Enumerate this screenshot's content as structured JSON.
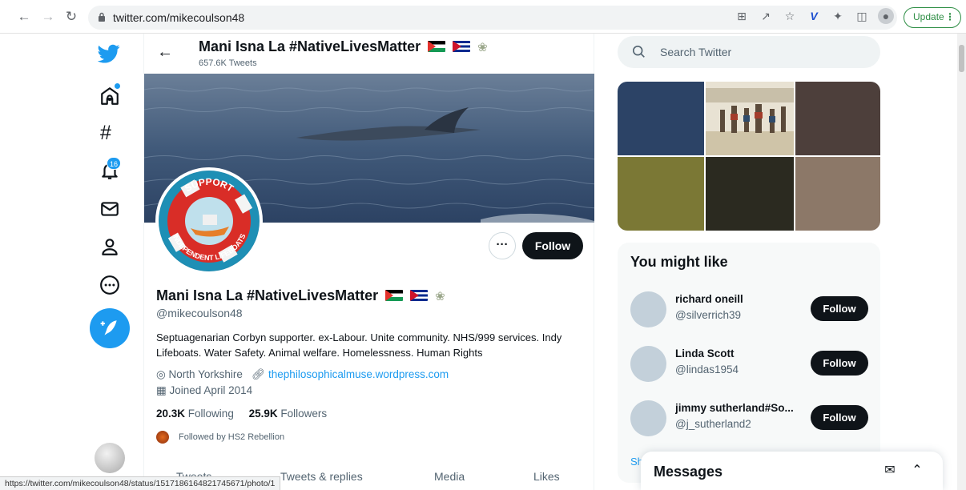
{
  "browser": {
    "url": "twitter.com/mikecoulson48",
    "update_label": "Update",
    "status_url": "https://twitter.com/mikecoulson48/status/1517186164821745671/photo/1"
  },
  "nav": {
    "notification_count": "16"
  },
  "header": {
    "name": "Mani Isna La #NativeLivesMatter",
    "tweets_count": "657.6K Tweets"
  },
  "profile": {
    "name": "Mani Isna La #NativeLivesMatter",
    "handle": "@mikecoulson48",
    "bio": "Septuagenarian Corbyn supporter. ex-Labour. Unite community. NHS/999 services. Indy Lifeboats. Water Safety. Animal welfare. Homelessness. Human Rights",
    "location": "North Yorkshire",
    "website": "thephilosophicalmuse.wordpress.com",
    "joined": "Joined April 2014",
    "following_count": "20.3K",
    "following_label": "Following",
    "followers_count": "25.9K",
    "followers_label": "Followers",
    "followed_by": "Followed by HS2 Rebellion",
    "follow_label": "Follow",
    "avatar_text_top": "SUPPORT",
    "avatar_text_bottom": "INDEPENDENT LIFEBOATS"
  },
  "tabs": [
    {
      "label": "Tweets"
    },
    {
      "label": "Tweets & replies"
    },
    {
      "label": "Media"
    },
    {
      "label": "Likes"
    }
  ],
  "search": {
    "placeholder": "Search Twitter"
  },
  "media_colors": [
    "#2c4366",
    "#cfc7b5",
    "#4d3f3b",
    "#7b7835",
    "#2b2a20",
    "#8c7868"
  ],
  "who_to_follow": {
    "title": "You might like",
    "users": [
      {
        "name": "richard oneill",
        "handle": "@silverrich39",
        "follow_label": "Follow"
      },
      {
        "name": "Linda Scott",
        "handle": "@lindas1954",
        "follow_label": "Follow"
      },
      {
        "name": "jimmy sutherland#So...",
        "handle": "@j_sutherland2",
        "follow_label": "Follow"
      }
    ],
    "show_more": "Sh"
  },
  "messages": {
    "title": "Messages"
  },
  "colors": {
    "accent": "#1d9bf0",
    "text": "#0f1419",
    "secondary": "#536471"
  }
}
